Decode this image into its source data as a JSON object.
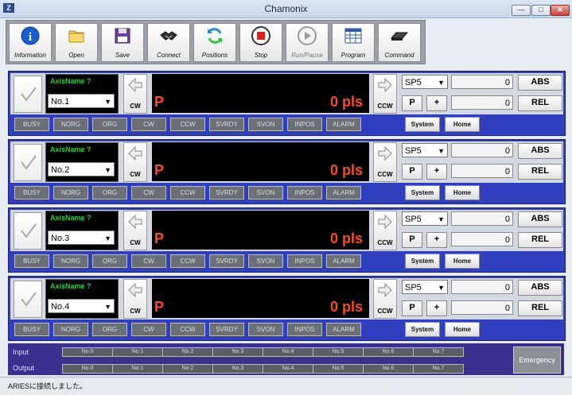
{
  "window": {
    "title": "Chamonix",
    "minimize": "—",
    "maximize": "□",
    "close": "✕"
  },
  "toolbar": [
    {
      "label": "Information",
      "icon": "info-icon",
      "enabled": true
    },
    {
      "label": "Open",
      "icon": "folder-icon",
      "enabled": true
    },
    {
      "label": "Save",
      "icon": "floppy-disk-icon",
      "enabled": true
    },
    {
      "label": "Connect",
      "icon": "handshake-icon",
      "enabled": true
    },
    {
      "label": "Positions",
      "icon": "refresh-arrows-icon",
      "enabled": true
    },
    {
      "label": "Stop",
      "icon": "stop-icon",
      "enabled": true
    },
    {
      "label": "Run/Pause",
      "icon": "play-icon",
      "enabled": false
    },
    {
      "label": "Program",
      "icon": "spreadsheet-icon",
      "enabled": true
    },
    {
      "label": "Command",
      "icon": "keyboard-icon",
      "enabled": true
    }
  ],
  "axes": [
    {
      "axis_name": "AxisName ?",
      "axis_select": "No.1",
      "display_prefix": "P",
      "display_value": "0 pls",
      "speed": "SP5",
      "abs_value": "0",
      "rel_value": "0"
    },
    {
      "axis_name": "AxisName ?",
      "axis_select": "No.2",
      "display_prefix": "P",
      "display_value": "0 pls",
      "speed": "SP5",
      "abs_value": "0",
      "rel_value": "0"
    },
    {
      "axis_name": "AxisName ?",
      "axis_select": "No.3",
      "display_prefix": "P",
      "display_value": "0 pls",
      "speed": "SP5",
      "abs_value": "0",
      "rel_value": "0"
    },
    {
      "axis_name": "AxisName ?",
      "axis_select": "No.4",
      "display_prefix": "P",
      "display_value": "0 pls",
      "speed": "SP5",
      "abs_value": "0",
      "rel_value": "0"
    }
  ],
  "axis_buttons": {
    "cw": "CW",
    "ccw": "CCW",
    "p": "P",
    "plus": "+",
    "abs": "ABS",
    "rel": "REL",
    "system": "System",
    "home": "Home"
  },
  "status_flags": [
    "BUSY",
    "NORG",
    "ORG",
    "CW",
    "CCW",
    "SVRDY",
    "SVON",
    "INPOS",
    "ALARM"
  ],
  "io": {
    "input_label": "Input",
    "output_label": "Output",
    "inputs": [
      "No.0",
      "No.1",
      "No.2",
      "No.3",
      "No.4",
      "No.5",
      "No.6",
      "No.7"
    ],
    "outputs": [
      "No.0",
      "No.1",
      "No.2",
      "No.3",
      "No.4",
      "No.5",
      "No.6",
      "No.7"
    ],
    "emergency": "Emergency"
  },
  "status_bar": {
    "text": "ARIESに接続しました。"
  }
}
